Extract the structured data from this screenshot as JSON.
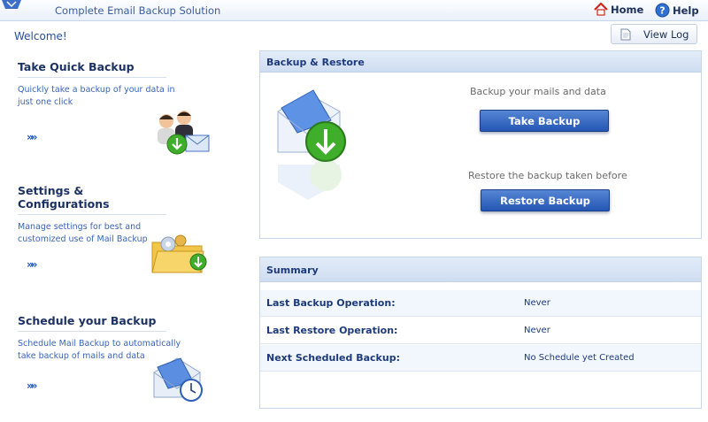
{
  "header": {
    "app_title": "Complete Email Backup Solution",
    "home_label": "Home",
    "help_label": "Help"
  },
  "welcome": "Welcome!",
  "view_log_label": "View Log",
  "cards": [
    {
      "title": "Take Quick Backup",
      "desc": "Quickly take a backup of your data in just one click",
      "icon": "users-backup-icon"
    },
    {
      "title": "Settings & Configurations",
      "desc": "Manage settings for best and customized use of Mail Backup",
      "icon": "settings-folder-icon"
    },
    {
      "title": "Schedule your Backup",
      "desc": "Schedule Mail Backup to automatically take backup of mails and data",
      "icon": "mail-clock-icon"
    }
  ],
  "backup_restore": {
    "title": "Backup & Restore",
    "backup_text": "Backup your mails and data",
    "backup_button": "Take Backup",
    "restore_text": "Restore the backup taken before",
    "restore_button": "Restore Backup",
    "icon": "mail-download-icon"
  },
  "summary": {
    "title": "Summary",
    "rows": [
      {
        "label": "Last Backup Operation:",
        "value": "Never"
      },
      {
        "label": "Last Restore Operation:",
        "value": "Never"
      },
      {
        "label": "Next Scheduled Backup:",
        "value": "No Schedule yet Created"
      }
    ]
  },
  "colors": {
    "accent": "#2456b4",
    "panel_header": "#d9e5f5",
    "text": "#1d3a7a"
  }
}
